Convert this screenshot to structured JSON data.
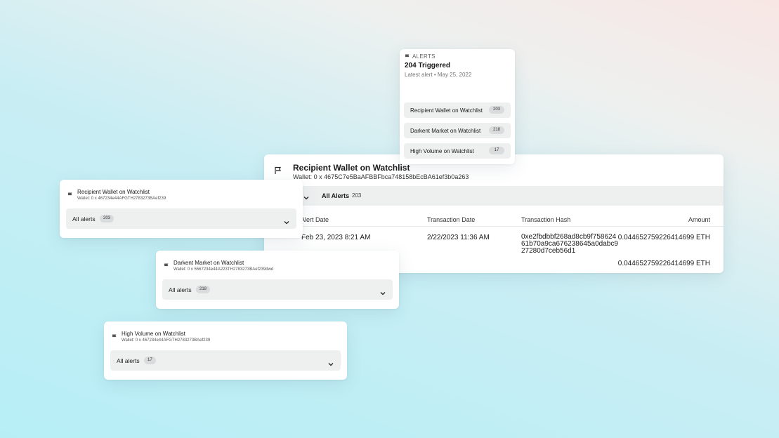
{
  "table_card": {
    "title": "Recipient Wallet on Watchlist",
    "wallet": "Wallet: 0 x 4675C7e5BaAFBBFbca748158bEcBA61ef3b0a263",
    "filter_label": "All Alerts",
    "filter_count": "203",
    "columns": [
      "Alert Date",
      "Transaction Date",
      "Transaction Hash",
      "Amount"
    ],
    "rows": [
      {
        "alert_date": "Feb 23, 2023 8:21 AM",
        "tx_date": "2/22/2023 11:36 AM",
        "tx_hash": "0xe2fbdbbf268ad8cb9f75862461b70a9ca676238645a0dabc927280d7ceb56d1",
        "amount": "0.044652759226414699 ETH"
      },
      {
        "alert_date": "",
        "tx_date": "",
        "tx_hash": "",
        "amount": "0.044652759226414699 ETH"
      }
    ]
  },
  "alerts_popup": {
    "heading": "ALERTS",
    "triggered": "204 Triggered",
    "latest_label": "Latest alert",
    "latest_date": "May 25, 2022",
    "items": [
      {
        "label": "Recipient Wallet on Watchlist",
        "count": "203"
      },
      {
        "label": "Darkent Market on Watchlist",
        "count": "218"
      },
      {
        "label": "High Volume on Watchlist",
        "count": "17"
      }
    ]
  },
  "watch_cards": [
    {
      "title": "Recipient Wallet on Watchlist",
      "wallet": "Wallet: 0 x 467234e44AFGTH2783273BAef239",
      "select_label": "All alerts",
      "count": "203"
    },
    {
      "title": "Darkent Market on Watchlist",
      "wallet": "Wallet: 0 x 5567234e44A223TH2783273BAef239dwd",
      "select_label": "All alerts",
      "count": "218"
    },
    {
      "title": "High Volume on Watchlist",
      "wallet": "Wallet: 0 x 467234e44AFGTH2783273BAef239",
      "select_label": "All alerts",
      "count": "17"
    }
  ],
  "icons": {
    "flag": "flag-icon",
    "chevron": "chevron-down-icon"
  }
}
